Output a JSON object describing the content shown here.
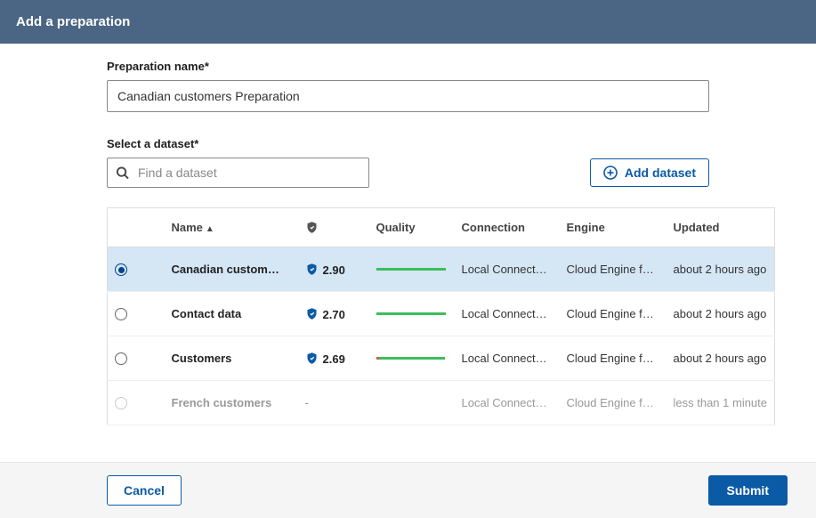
{
  "header": {
    "title": "Add a preparation"
  },
  "form": {
    "name_label": "Preparation name*",
    "name_value": "Canadian customers Preparation",
    "dataset_label": "Select a dataset*",
    "search_placeholder": "Find a dataset",
    "add_dataset_label": "Add dataset"
  },
  "columns": {
    "name": "Name",
    "quality": "Quality",
    "connection": "Connection",
    "engine": "Engine",
    "updated": "Updated"
  },
  "rows": [
    {
      "selected": true,
      "name": "Canadian custom…",
      "trust": "2.90",
      "quality_red_pct": 0,
      "quality_green_pct": 100,
      "connection": "Local Connect…",
      "engine": "Cloud Engine f…",
      "updated": "about 2 hours ago",
      "disabled": false
    },
    {
      "selected": false,
      "name": "Contact data",
      "trust": "2.70",
      "quality_red_pct": 0,
      "quality_green_pct": 100,
      "connection": "Local Connect…",
      "engine": "Cloud Engine f…",
      "updated": "about 2 hours ago",
      "disabled": false
    },
    {
      "selected": false,
      "name": "Customers",
      "trust": "2.69",
      "quality_red_pct": 5,
      "quality_green_pct": 95,
      "connection": "Local Connect…",
      "engine": "Cloud Engine f…",
      "updated": "about 2 hours ago",
      "disabled": false
    },
    {
      "selected": false,
      "name": "French customers",
      "trust": "-",
      "quality_red_pct": 0,
      "quality_green_pct": 0,
      "connection": "Local Connect…",
      "engine": "Cloud Engine f…",
      "updated": "less than 1 minute",
      "disabled": true
    }
  ],
  "footer": {
    "cancel": "Cancel",
    "submit": "Submit"
  }
}
